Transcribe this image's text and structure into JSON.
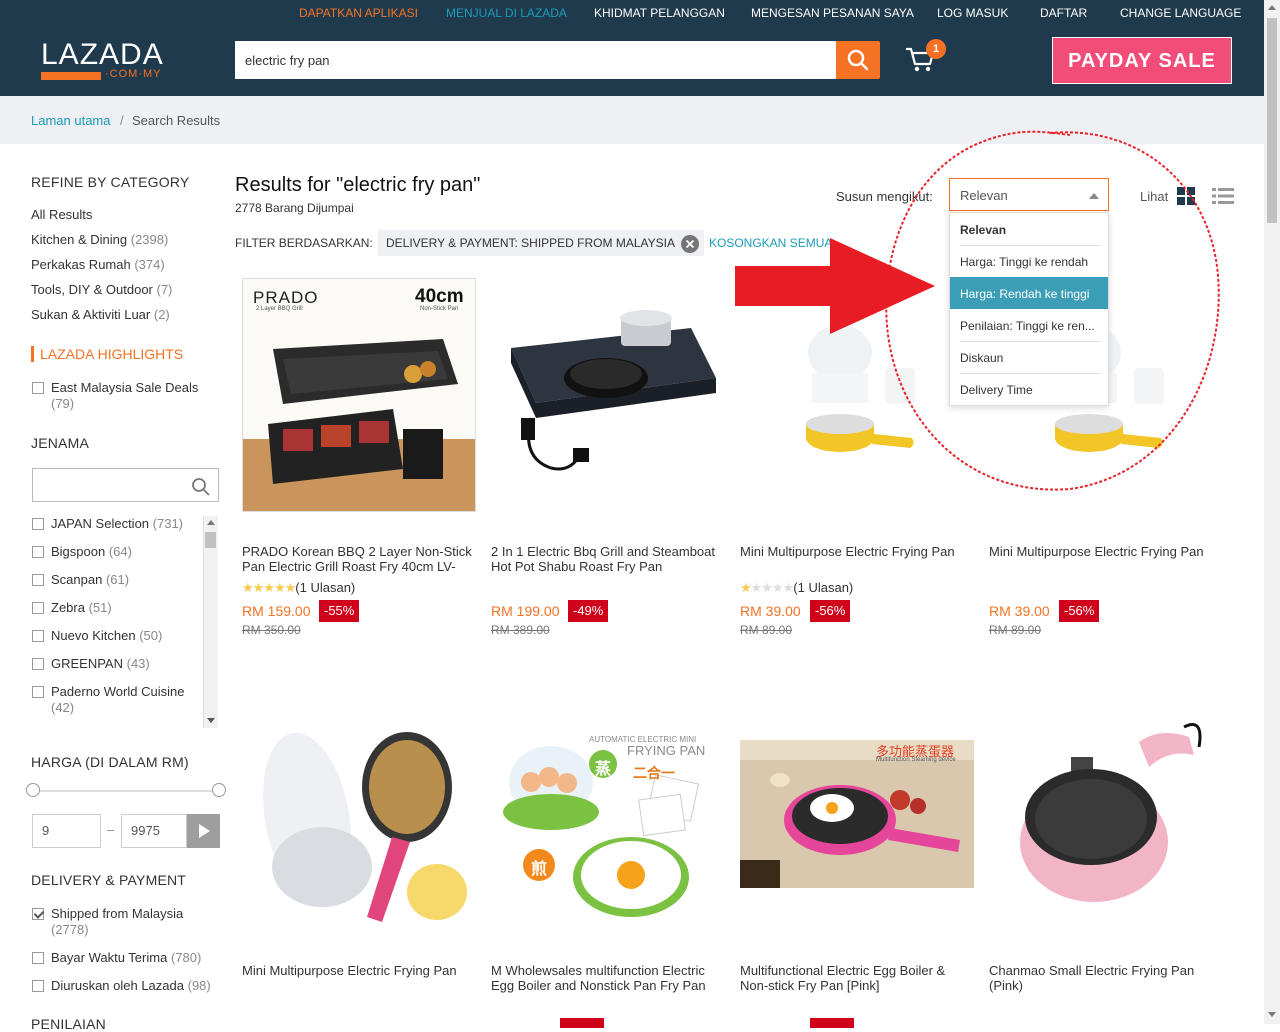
{
  "topbar": {
    "links": [
      "DAPATKAN APLIKASI",
      "MENJUAL DI LAZADA",
      "KHIDMAT PELANGGAN",
      "MENGESAN PESANAN SAYA",
      "LOG MASUK",
      "DAFTAR",
      "CHANGE LANGUAGE"
    ],
    "colors": {
      "bg": "#1f3a4d",
      "orange": "#f57224",
      "teal": "#1a9cb7"
    }
  },
  "header": {
    "logo_word": "LAZADA",
    "logo_domain": "·COM·MY",
    "search_value": "electric fry pan",
    "cart_count": "1",
    "payday_label": "PAYDAY SALE"
  },
  "breadcrumb": {
    "home": "Laman utama",
    "separator": "/",
    "current": "Search Results"
  },
  "sidebar": {
    "category_heading": "REFINE BY CATEGORY",
    "categories": [
      {
        "name": "All Results",
        "count": ""
      },
      {
        "name": "Kitchen & Dining",
        "count": "(2398)"
      },
      {
        "name": "Perkakas Rumah",
        "count": "(374)"
      },
      {
        "name": "Tools, DIY & Outdoor",
        "count": "(7)"
      },
      {
        "name": "Sukan & Aktiviti Luar",
        "count": "(2)"
      }
    ],
    "highlights_heading": "LAZADA HIGHLIGHTS",
    "highlights": [
      {
        "label": "East Malaysia Sale Deals",
        "count": "(79)"
      }
    ],
    "brand_heading": "JENAMA",
    "brands": [
      {
        "label": "JAPAN Selection",
        "count": "(731)"
      },
      {
        "label": "Bigspoon",
        "count": "(64)"
      },
      {
        "label": "Scanpan",
        "count": "(61)"
      },
      {
        "label": "Zebra",
        "count": "(51)"
      },
      {
        "label": "Nuevo Kitchen",
        "count": "(50)"
      },
      {
        "label": "GREENPAN",
        "count": "(43)"
      },
      {
        "label": "Paderno World Cuisine",
        "count": "(42)"
      }
    ],
    "price_heading": "HARGA (DI DALAM RM)",
    "price_min": "9",
    "price_dash": "–",
    "price_max": "9975",
    "delivery_heading": "DELIVERY & PAYMENT",
    "delivery": [
      {
        "label": "Shipped from Malaysia",
        "count": "(2778)",
        "checked": true
      },
      {
        "label": "Bayar Waktu Terima",
        "count": "(780)",
        "checked": false
      },
      {
        "label": "Diuruskan oleh Lazada",
        "count": "(98)",
        "checked": false
      }
    ],
    "rating_heading": "PENILAIAN"
  },
  "results": {
    "title": "Results for \"electric fry pan\"",
    "count": "2778 Barang Dijumpai",
    "filter_label": "FILTER BERDASARKAN:",
    "filter_chip": "DELIVERY & PAYMENT: SHIPPED FROM MALAYSIA",
    "clear_all": "KOSONGKAN SEMUA",
    "sort_label": "Susun mengikut:",
    "sort_selected": "Relevan",
    "sort_options": [
      "Relevan",
      "Harga: Tinggi ke rendah",
      "Harga: Rendah ke tinggi",
      "Penilaian: Tinggi ke ren...",
      "Diskaun",
      "Delivery Time"
    ],
    "sort_hovered_index": 2,
    "view_label": "Lihat"
  },
  "products": [
    {
      "title": "PRADO Korean BBQ 2 Layer Non-Stick Pan Electric Grill Roast Fry 40cm LV-",
      "rating_stars": 5,
      "reviews": "(1 Ulasan)",
      "price": "RM 159.00",
      "discount": "-55%",
      "original": "RM 350.00",
      "img_text_1": "PRADO",
      "img_text_2": "40cm",
      "img_text_3": "2 Layer BBQ Grill",
      "img_text_4": "Non-Stick Pan"
    },
    {
      "title": "2 In 1 Electric Bbq Grill and Steamboat Hot Pot Shabu Roast Fry Pan",
      "rating_stars": 0,
      "reviews": "",
      "price": "RM 199.00",
      "discount": "-49%",
      "original": "RM 389.00"
    },
    {
      "title": "Mini Multipurpose Electric Frying Pan",
      "rating_stars": 1,
      "reviews": "(1 Ulasan)",
      "price": "RM 39.00",
      "discount": "-56%",
      "original": "RM 89.00"
    },
    {
      "title": "Mini Multipurpose Electric Frying Pan",
      "rating_stars": 0,
      "reviews": "",
      "price": "RM 39.00",
      "discount": "-56%",
      "original": "RM 89.00"
    },
    {
      "title": "Mini Multipurpose Electric Frying Pan",
      "rating_stars": 0,
      "reviews": "",
      "price": "",
      "discount": "",
      "original": ""
    },
    {
      "title": "M Wholewsales multifunction Electric Egg Boiler and Nonstick Pan Fry Pan",
      "rating_stars": 0,
      "reviews": "",
      "price": "",
      "discount": "",
      "original": "",
      "img_text_1": "AUTOMATIC ELECTRIC MINI",
      "img_text_2": "FRYING PAN",
      "img_text_3": "蒸",
      "img_text_4": "二合一",
      "img_text_5": "煎"
    },
    {
      "title": "Multifunctional Electric Egg Boiler & Non-stick Fry Pan [Pink]",
      "rating_stars": 0,
      "reviews": "",
      "price": "",
      "discount": "",
      "original": "",
      "img_text_1": "多功能蒸蛋器",
      "img_text_2": "Multifunction Steaming device"
    },
    {
      "title": "Chanmao Small Electric Frying Pan (Pink)",
      "rating_stars": 0,
      "reviews": "",
      "price": "",
      "discount": "",
      "original": ""
    }
  ]
}
